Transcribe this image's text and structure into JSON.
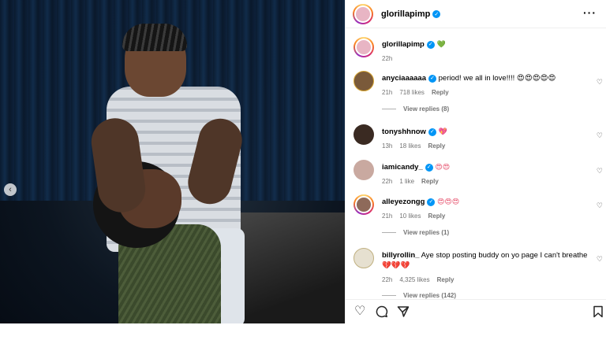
{
  "post": {
    "username": "glorillapimp",
    "caption_emoji": "💚",
    "time": "22h"
  },
  "comments": [
    {
      "username": "anyciaaaaaa",
      "text": "period! we all in love!!!! 😍😍😍😍😍",
      "time": "21h",
      "likes": "718 likes",
      "reply": "Reply",
      "view_replies": "View replies (8)"
    },
    {
      "username": "tonyshhnow",
      "text": "💖",
      "time": "13h",
      "likes": "18 likes",
      "reply": "Reply"
    },
    {
      "username": "iamicandy_",
      "text": "😍😍",
      "time": "22h",
      "likes": "1 like",
      "reply": "Reply"
    },
    {
      "username": "alleyezongg",
      "text": "😍😍😍",
      "time": "21h",
      "likes": "10 likes",
      "reply": "Reply",
      "view_replies": "View replies (1)"
    },
    {
      "username": "billyrollin_",
      "text": "Aye stop posting buddy on yo page I can't breathe 💔💔💔",
      "time": "22h",
      "likes": "4,325 likes",
      "reply": "Reply",
      "view_replies": "View replies (142)"
    }
  ],
  "icons": {
    "more": "more-options-icon",
    "heart": "heart-icon",
    "comment": "comment-icon",
    "share": "share-icon",
    "save": "bookmark-icon",
    "carousel_prev": "chevron-left-icon",
    "verified": "verified-badge-icon"
  },
  "colors": {
    "verified": "#0095f6",
    "muted_text": "#737373"
  }
}
